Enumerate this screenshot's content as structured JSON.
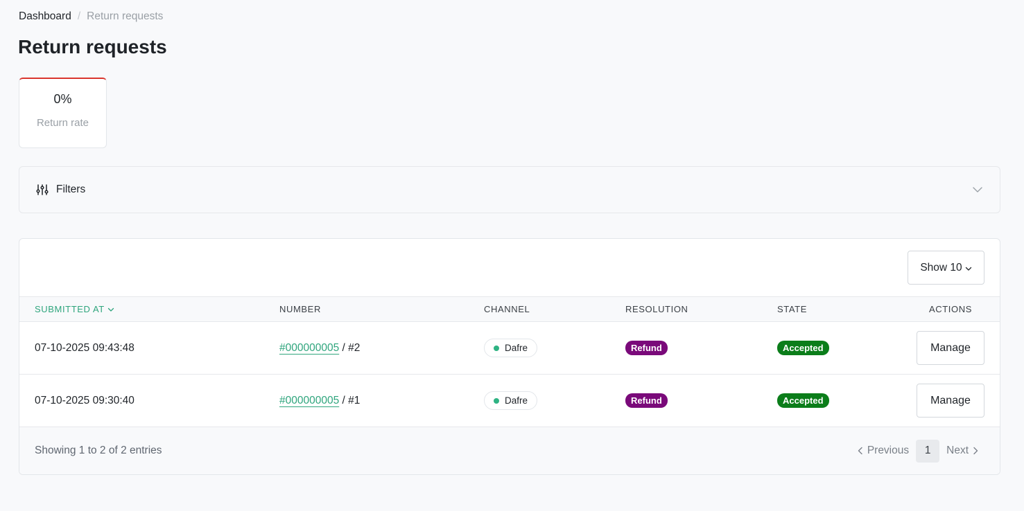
{
  "breadcrumb": {
    "home": "Dashboard",
    "separator": "/",
    "current": "Return requests"
  },
  "page_title": "Return requests",
  "stats": {
    "return_rate_value": "0%",
    "return_rate_label": "Return rate",
    "accent_color": "#d9352c"
  },
  "filters": {
    "label": "Filters",
    "icon": "sliders-icon",
    "toggle_icon": "chevron-down-icon"
  },
  "table": {
    "page_size_label": "Show 10",
    "columns": {
      "submitted_at": "SUBMITTED AT",
      "number": "NUMBER",
      "channel": "CHANNEL",
      "resolution": "RESOLUTION",
      "state": "STATE",
      "actions": "ACTIONS"
    },
    "rows": [
      {
        "submitted_at": "07-10-2025 09:43:48",
        "order_number": "#000000005",
        "return_suffix": " / #2",
        "channel": "Dafre",
        "resolution": "Refund",
        "state": "Accepted",
        "action_label": "Manage"
      },
      {
        "submitted_at": "07-10-2025 09:30:40",
        "order_number": "#000000005",
        "return_suffix": " / #1",
        "channel": "Dafre",
        "resolution": "Refund",
        "state": "Accepted",
        "action_label": "Manage"
      }
    ],
    "footer": {
      "entries_text": "Showing 1 to 2 of 2 entries",
      "previous_label": "Previous",
      "current_page": "1",
      "next_label": "Next"
    }
  },
  "colors": {
    "link_green": "#2fa57d",
    "channel_dot": "#2fb383",
    "refund_badge": "#7a0a7a",
    "accepted_badge": "#0b7d1a"
  }
}
